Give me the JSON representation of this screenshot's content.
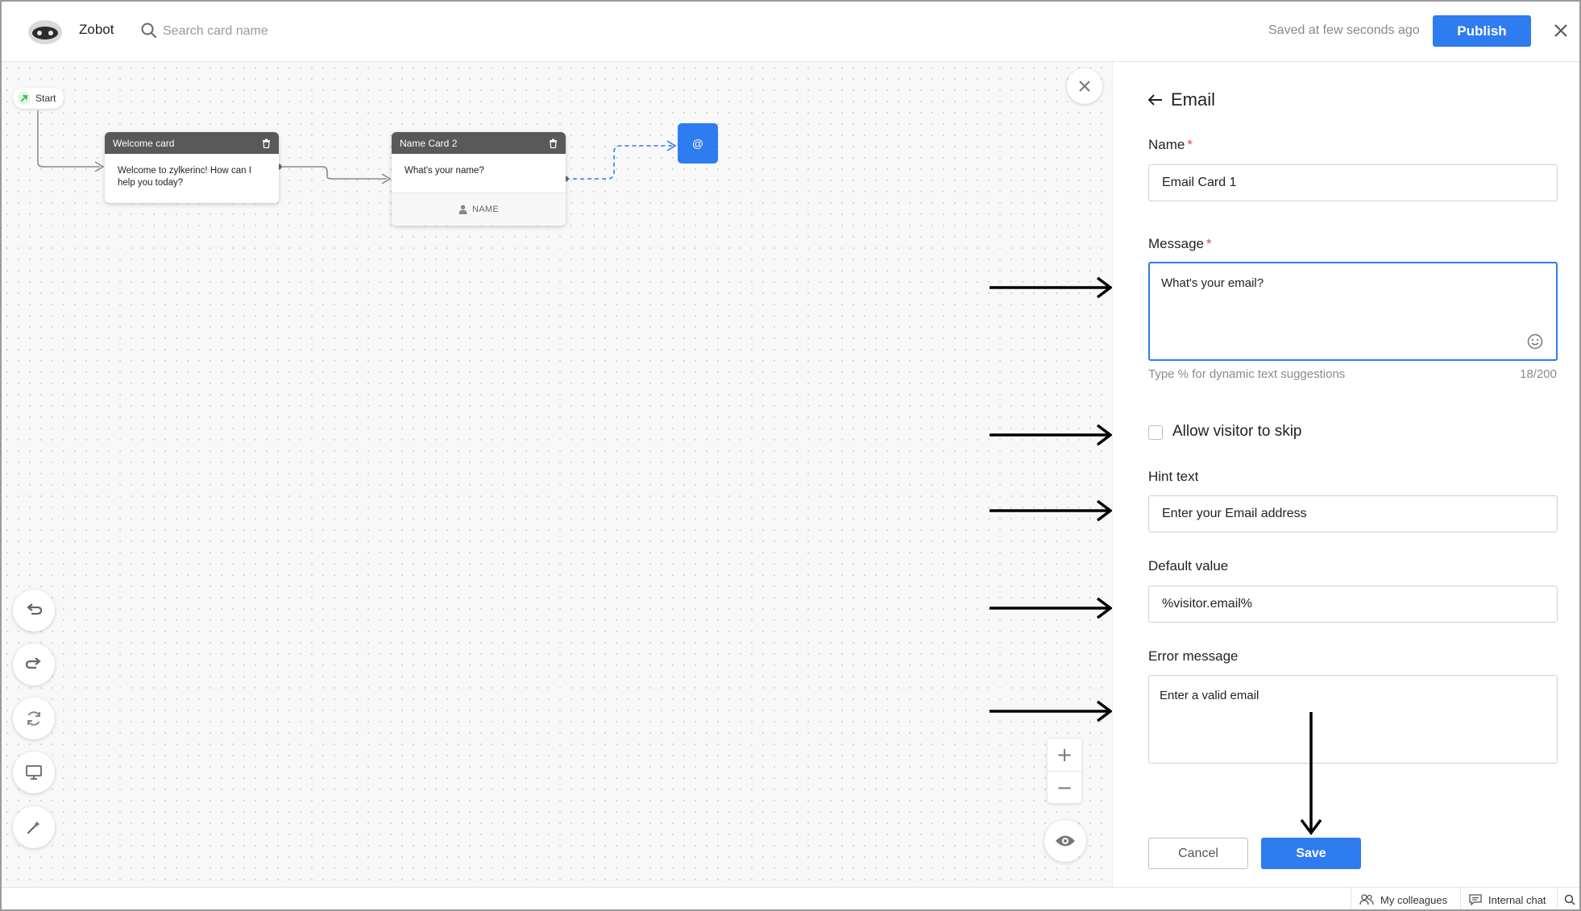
{
  "app": {
    "name": "Zobot",
    "search_placeholder": "Search card name",
    "saved_status": "Saved at few seconds ago",
    "publish_label": "Publish"
  },
  "canvas": {
    "start_label": "Start",
    "cards": [
      {
        "title": "Welcome card",
        "message": "Welcome to zylkerinc! How can I help you today?"
      },
      {
        "title": "Name Card 2",
        "message": "What's your name?",
        "footer": "NAME"
      }
    ],
    "email_node_symbol": "@",
    "tools": [
      "undo-icon",
      "redo-icon",
      "refresh-icon",
      "monitor-icon",
      "magic-wand-icon"
    ],
    "zoom_in": "+",
    "zoom_out": "−"
  },
  "panel": {
    "title": "Email",
    "name_label": "Name",
    "name_value": "Email Card 1",
    "message_label": "Message",
    "message_value": "What's your email?",
    "message_hint": "Type % for dynamic text suggestions",
    "message_count": "18/200",
    "skip_label": "Allow visitor to skip",
    "skip_checked": false,
    "hint_label": "Hint text",
    "hint_value": "Enter your Email address",
    "default_label": "Default value",
    "default_value": "%visitor.email%",
    "error_label": "Error message",
    "error_value": "Enter a valid email",
    "cancel_label": "Cancel",
    "save_label": "Save",
    "required_mark": "*"
  },
  "bottombar": {
    "colleagues_label": "My colleagues",
    "chat_label": "Internal chat"
  },
  "colors": {
    "accent": "#2f7bf0",
    "card_header": "#595959",
    "required": "#e5484d"
  }
}
